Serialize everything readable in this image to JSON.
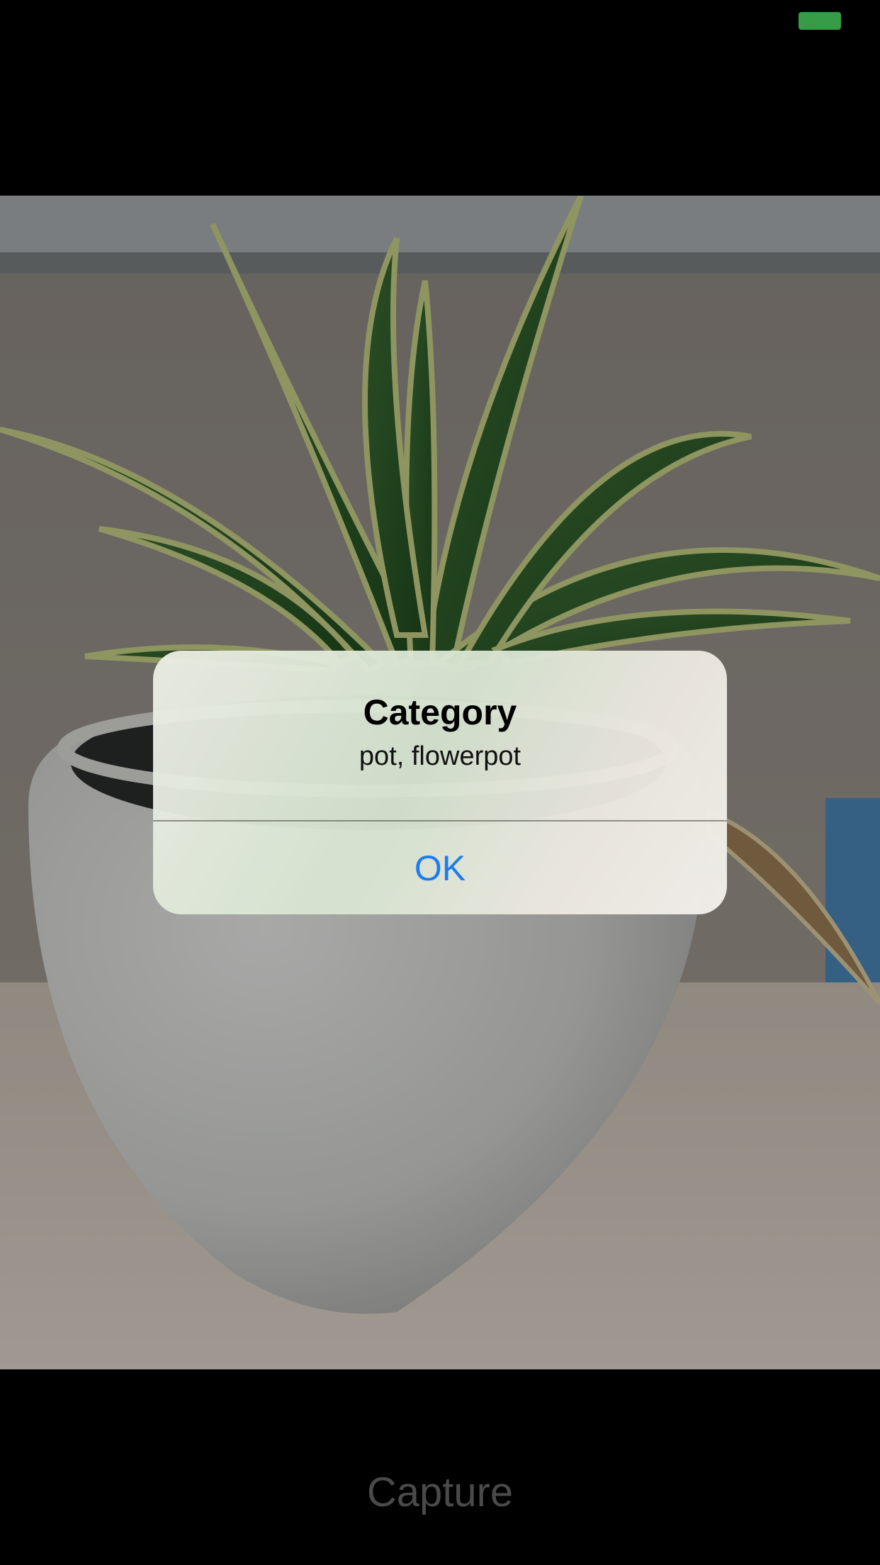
{
  "status_bar": {
    "battery_color": "#4cd964"
  },
  "camera_preview": {
    "icon": "plant-in-pot-photo"
  },
  "alert": {
    "title": "Category",
    "message": "pot, flowerpot",
    "ok_label": "OK",
    "ok_color": "#1f7cf0"
  },
  "capture": {
    "label": "Capture"
  }
}
